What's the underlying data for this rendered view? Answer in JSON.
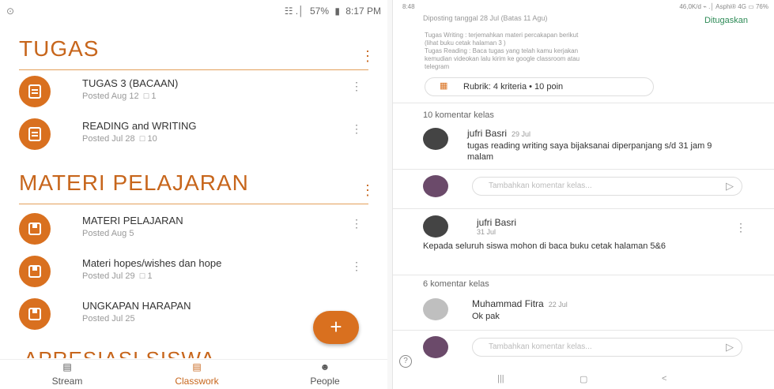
{
  "left": {
    "status": {
      "left_glyph": "⊙",
      "battery": "57%",
      "time": "8:17 PM",
      "signal_glyph": "☷ .│"
    },
    "sections": [
      {
        "title": "TUGAS",
        "items": [
          {
            "title": "TUGAS 3 (BACAAN)",
            "posted": "Posted Aug 12",
            "comments": "1"
          },
          {
            "title": "READING and WRITING",
            "posted": "Posted Jul 28",
            "comments": "10"
          }
        ]
      },
      {
        "title": "MATERI PELAJARAN",
        "items": [
          {
            "title": "MATERI PELAJARAN",
            "posted": "Posted Aug 5",
            "comments": ""
          },
          {
            "title": "Materi hopes/wishes dan hope",
            "posted": "Posted Jul 29",
            "comments": "1"
          },
          {
            "title": "UNGKAPAN HARAPAN",
            "posted": "Posted Jul 25",
            "comments": ""
          }
        ]
      }
    ],
    "cut_section_title": "APRESIASI SISWA",
    "fab_label": "+",
    "nav": [
      {
        "label": "Stream",
        "active": false
      },
      {
        "label": "Classwork",
        "active": true
      },
      {
        "label": "People",
        "active": false
      }
    ]
  },
  "right": {
    "status_left": "8:48",
    "status_right": "46,0K/d ⌁ .│ Asphi® 4G ▭ 76%",
    "due": "Diposting tanggal 28 Jul (Batas 11 Agu)",
    "assigned": "Ditugaskan",
    "desc_lines": [
      "Tugas Writing : terjemahkan materi percakapan berikut",
      "(lihat buku cetak halaman 3 )",
      "Tugas Reading : Baca tugas yang telah kamu kerjakan",
      "kemudian videokan lalu kirim ke google classroom atau",
      "telegram"
    ],
    "rubric": "Rubrik: 4 kriteria • 10 poin",
    "comments_count_1": "10 komentar kelas",
    "comment_1": {
      "name": "jufri Basri",
      "date": "29 Jul",
      "text": "tugas reading writing saya bijaksanai diperpanjang s/d 31 jam 9 malam"
    },
    "input_placeholder": "Tambahkan komentar kelas...",
    "post": {
      "name": "jufri Basri",
      "date": "31 Jul",
      "text": "Kepada seluruh siswa mohon di baca buku cetak halaman 5&6"
    },
    "comments_count_2": "6 komentar kelas",
    "comment_2": {
      "name": "Muhammad Fitra",
      "date": "22 Jul",
      "text": "Ok pak"
    },
    "help": "?",
    "sys_nav": [
      "|||",
      "▢",
      "<"
    ]
  },
  "colors": {
    "accent": "#d9701f",
    "section_title": "#c7661c",
    "assigned": "#2e8b57"
  }
}
